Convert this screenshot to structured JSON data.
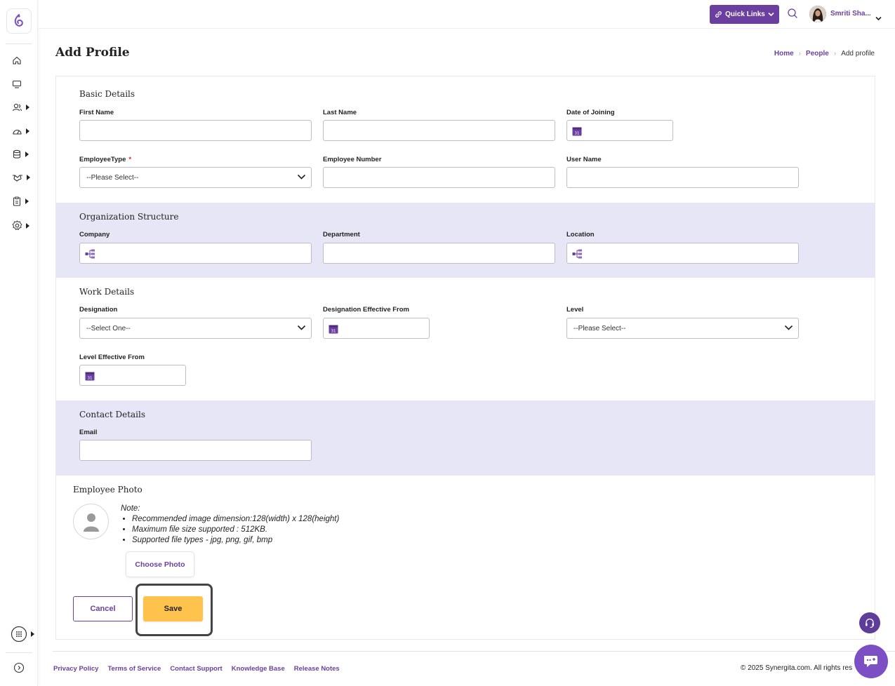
{
  "header": {
    "quick_links": "Quick Links",
    "user_name": "Smriti Sha..."
  },
  "page": {
    "title": "Add Profile",
    "breadcrumb": [
      "Home",
      "People",
      "Add profile"
    ]
  },
  "basic_details": {
    "title": "Basic Details",
    "first_name": "First Name",
    "last_name": "Last Name",
    "date_of_joining": "Date of Joining",
    "employee_type": "EmployeeType",
    "required_mark": "*",
    "employee_type_value": "--Please Select--",
    "employee_number": "Employee Number",
    "user_name": "User Name"
  },
  "organization": {
    "title": "Organization Structure",
    "company": "Company",
    "department": "Department",
    "location": "Location"
  },
  "work": {
    "title": "Work Details",
    "designation": "Designation",
    "designation_value": "--Select One--",
    "designation_effective": "Designation Effective From",
    "level": "Level",
    "level_value": "--Please Select--",
    "level_effective": "Level Effective From"
  },
  "contact": {
    "title": "Contact Details",
    "email": "Email"
  },
  "photo": {
    "title": "Employee Photo",
    "note_label": "Note:",
    "notes": [
      "Recommended image dimension:128(width) x 128(height)",
      "Maximum file size supported : 512KB.",
      "Supported file types - jpg, png, gif, bmp"
    ],
    "choose_label": "Choose Photo"
  },
  "actions": {
    "cancel": "Cancel",
    "save": "Save"
  },
  "footer": {
    "links": [
      "Privacy Policy",
      "Terms of Service",
      "Contact Support",
      "Knowledge Base",
      "Release Notes"
    ],
    "copyright": "© 2025 Synergita.com. All rights res"
  },
  "colors": {
    "brand": "#6b3fa0",
    "band": "#e6e6f6",
    "save": "#ffc34d"
  },
  "icons": [
    "home-icon",
    "monitor-icon",
    "people-icon",
    "dashboard-icon",
    "database-icon",
    "handshake-icon",
    "clipboard-icon",
    "settings-icon",
    "apps-icon",
    "expand-icon",
    "calendar-icon",
    "org-chart-icon",
    "search-icon",
    "link-icon",
    "headset-icon",
    "chat-icon"
  ]
}
